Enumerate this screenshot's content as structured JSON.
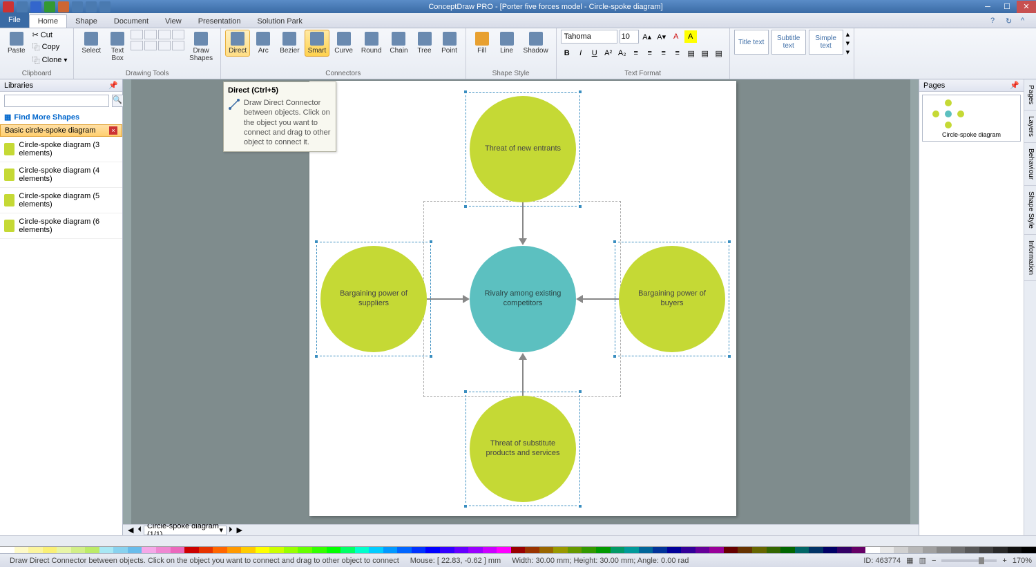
{
  "window": {
    "title": "ConceptDraw PRO - [Porter five forces model - Circle-spoke diagram]"
  },
  "menu": {
    "file": "File",
    "tabs": [
      "Home",
      "Shape",
      "Document",
      "View",
      "Presentation",
      "Solution Park"
    ],
    "active": "Home"
  },
  "ribbon": {
    "clipboard": {
      "label": "Clipboard",
      "paste": "Paste",
      "cut": "Cut",
      "copy": "Copy",
      "clone": "Clone"
    },
    "drawing": {
      "label": "Drawing Tools",
      "select": "Select",
      "textbox": "Text\nBox",
      "shapes": "Draw\nShapes"
    },
    "connectors": {
      "label": "Connectors",
      "direct": "Direct",
      "arc": "Arc",
      "bezier": "Bezier",
      "smart": "Smart",
      "curve": "Curve",
      "round": "Round",
      "chain": "Chain",
      "tree": "Tree",
      "point": "Point"
    },
    "shapestyle": {
      "label": "Shape Style",
      "fill": "Fill",
      "line": "Line",
      "shadow": "Shadow"
    },
    "textformat": {
      "label": "Text Format",
      "font": "Tahoma",
      "size": "10"
    },
    "textstyles": {
      "title": "Title text",
      "subtitle": "Subtitle text",
      "simple": "Simple text"
    }
  },
  "tooltip": {
    "title": "Direct (Ctrl+5)",
    "text": "Draw Direct Connector between objects. Click on the object you want to connect and drag to other object to connect it."
  },
  "libraries": {
    "header": "Libraries",
    "find": "Find More Shapes",
    "category": "Basic circle-spoke diagram",
    "items": [
      "Circle-spoke diagram (3 elements)",
      "Circle-spoke diagram (4 elements)",
      "Circle-spoke diagram (5 elements)",
      "Circle-spoke diagram (6 elements)"
    ]
  },
  "diagram": {
    "top": "Threat of new entrants",
    "center": "Rivalry among existing competitors",
    "left": "Bargaining power of suppliers",
    "right": "Bargaining power of buyers",
    "bottom": "Threat of substitute products and services"
  },
  "pages": {
    "header": "Pages",
    "current": "Circle-spoke diagram (1/1)",
    "thumb_label": "Circle-spoke diagram"
  },
  "side_tabs": [
    "Pages",
    "Layers",
    "Behaviour",
    "Shape Style",
    "Information"
  ],
  "status": {
    "hint": "Draw Direct Connector between objects. Click on the object you want to connect and drag to other object to connect",
    "mouse": "Mouse: [ 22.83, -0.62 ] mm",
    "dims": "Width: 30.00 mm;  Height: 30.00 mm;  Angle: 0.00 rad",
    "id": "ID: 463774",
    "zoom": "170%"
  },
  "colors": [
    "#ffffff",
    "#fefac8",
    "#fcf59e",
    "#faf076",
    "#e8f5a8",
    "#d2ef88",
    "#bceb68",
    "#a8e8f5",
    "#88d2ef",
    "#68bceb",
    "#f5a8e8",
    "#ef88d2",
    "#eb68bc",
    "#cc0000",
    "#e63300",
    "#ff6600",
    "#ff9900",
    "#ffcc00",
    "#ffff00",
    "#ccff00",
    "#99ff00",
    "#66ff00",
    "#33ff00",
    "#00ff00",
    "#00ff66",
    "#00ffcc",
    "#00ccff",
    "#0099ff",
    "#0066ff",
    "#0033ff",
    "#0000ff",
    "#3300ff",
    "#6600ff",
    "#9900ff",
    "#cc00ff",
    "#ff00ff",
    "#990000",
    "#993300",
    "#996600",
    "#999900",
    "#669900",
    "#339900",
    "#009900",
    "#009966",
    "#009999",
    "#006699",
    "#003399",
    "#000099",
    "#330099",
    "#660099",
    "#990099",
    "#660000",
    "#663300",
    "#666600",
    "#336600",
    "#006600",
    "#006666",
    "#003366",
    "#000066",
    "#330066",
    "#660066",
    "#ffffff",
    "#e8e8e8",
    "#d0d0d0",
    "#b8b8b8",
    "#a0a0a0",
    "#888888",
    "#707070",
    "#585858",
    "#404040",
    "#282828",
    "#101010",
    "#000000"
  ]
}
